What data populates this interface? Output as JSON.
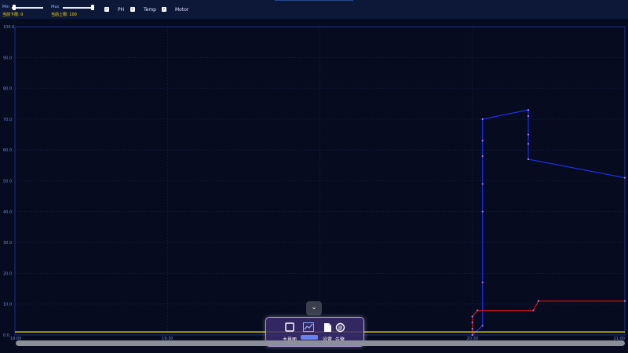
{
  "range": {
    "min_label": "Min",
    "max_label": "Max",
    "min_current": "当前下限: 0",
    "max_current": "当前上限: 100"
  },
  "series_toggles": [
    {
      "label": "PH",
      "checked": true,
      "icon": "check-icon"
    },
    {
      "label": "Temp",
      "checked": true,
      "icon": "check-icon"
    },
    {
      "label": "Motor",
      "checked": true,
      "icon": "check-icon"
    }
  ],
  "chart_data": {
    "type": "line",
    "ylim": [
      0,
      100
    ],
    "y_ticks": [
      "0.0",
      "10.0",
      "20.0",
      "30.0",
      "40.0",
      "50.0",
      "60.0",
      "70.0",
      "80.0",
      "90.0",
      "100.0"
    ],
    "x_ticks": [
      "19:00",
      "19:30",
      "20:00",
      "20:30",
      "21:00"
    ],
    "grid": true,
    "series": [
      {
        "color": "#1f2eea",
        "x": [
          "20:30",
          "20:32",
          "20:32",
          "20:32",
          "20:32",
          "20:32",
          "20:32",
          "20:32",
          "20:41",
          "20:41",
          "20:41",
          "20:41",
          "20:41",
          "21:00"
        ],
        "y": [
          0,
          3,
          17,
          40,
          49,
          58,
          63,
          70,
          73,
          71,
          65,
          62,
          57,
          51
        ]
      },
      {
        "color": "#e01010",
        "x": [
          "20:30",
          "20:30",
          "20:30",
          "20:30",
          "20:31",
          "20:42",
          "20:43",
          "21:00"
        ],
        "y": [
          0,
          2,
          4,
          6,
          8,
          8,
          11,
          11
        ]
      },
      {
        "color": "#ffee00",
        "x": [
          "19:00",
          "21:00"
        ],
        "y": [
          1,
          1
        ]
      }
    ]
  },
  "toolbar": {
    "items": [
      {
        "label": "主界面",
        "icon": "square-icon"
      },
      {
        "label": "趋势",
        "icon": "chart-icon"
      },
      {
        "label": "设置",
        "icon": "document-icon"
      },
      {
        "label": "告警",
        "icon": "search-icon"
      }
    ],
    "collapse_icon": "chevron-down-icon"
  },
  "colors": {
    "background": "#060b1f",
    "grid": "#1a2545",
    "tick": "#6f86d9",
    "accent": "#6d8cff"
  }
}
